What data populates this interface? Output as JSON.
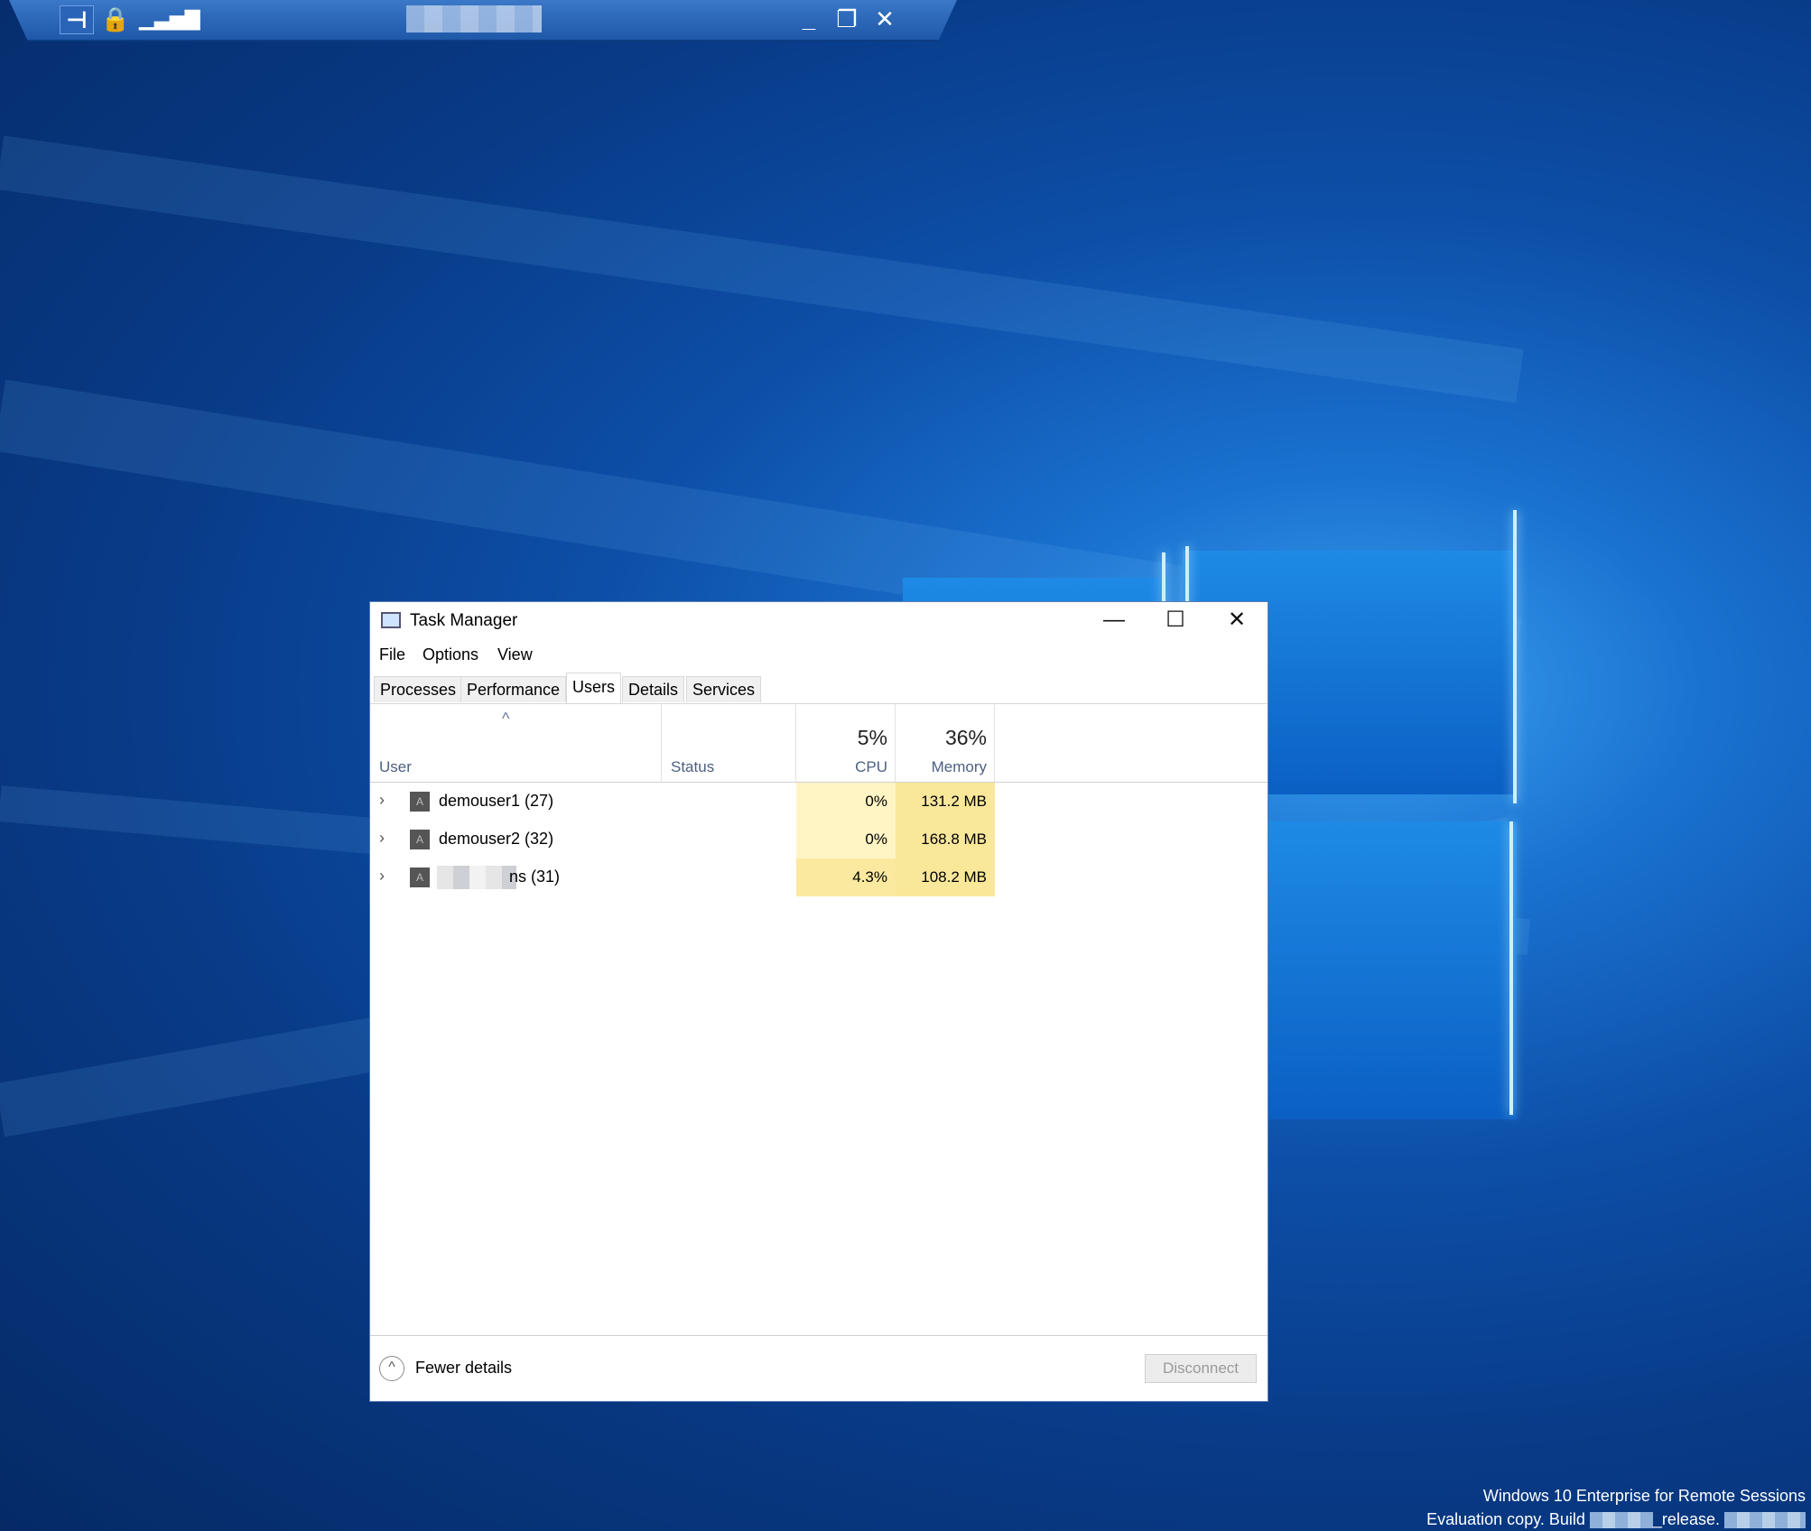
{
  "rdp_bar": {
    "pin_icon": "pin-icon",
    "lock_icon": "lock-icon",
    "signal_icon": "signal-icon",
    "minimize_icon": "minimize-icon",
    "restore_icon": "restore-icon",
    "close_icon": "close-icon"
  },
  "task_manager": {
    "title": "Task Manager",
    "menu": [
      "File",
      "Options",
      "View"
    ],
    "tabs": [
      "Processes",
      "Performance",
      "Users",
      "Details",
      "Services"
    ],
    "active_tab": "Users",
    "columns": {
      "user": "User",
      "status": "Status",
      "cpu_total": "5%",
      "cpu": "CPU",
      "memory_total": "36%",
      "memory": "Memory"
    },
    "rows": [
      {
        "name": "demouser1 (27)",
        "status": "",
        "cpu": "0%",
        "memory": "131.2 MB"
      },
      {
        "name": "demouser2 (32)",
        "status": "",
        "cpu": "0%",
        "memory": "168.8 MB"
      },
      {
        "name": "ns (31)",
        "status": "",
        "cpu": "4.3%",
        "memory": "108.2 MB"
      }
    ],
    "fewer_details": "Fewer details",
    "disconnect": "Disconnect"
  },
  "colors": {
    "cpu_low": "#fff4c4",
    "cpu_mid": "#fbe9a0",
    "mem": "#f9e79a"
  },
  "watermark": {
    "line1": "Windows 10 Enterprise for Remote Sessions",
    "line2_prefix": "Evaluation copy. Build",
    "line2_mid": "_release."
  }
}
